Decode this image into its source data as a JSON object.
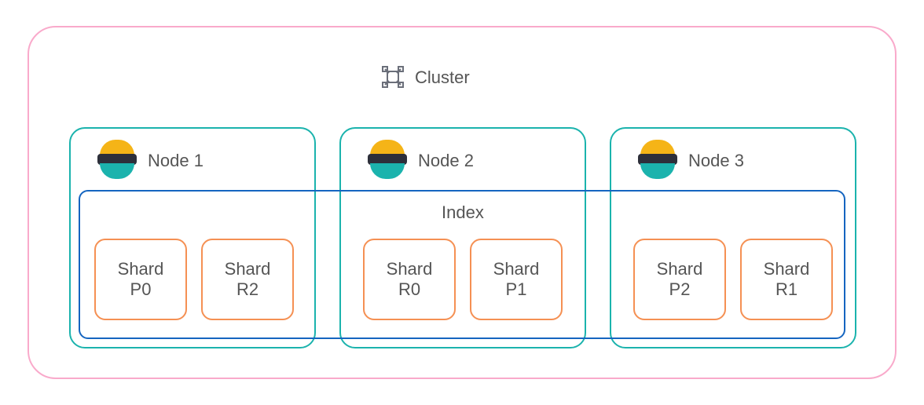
{
  "cluster": {
    "label": "Cluster"
  },
  "index": {
    "label": "Index"
  },
  "nodes": [
    {
      "label": "Node 1",
      "shards": [
        {
          "t1": "Shard",
          "t2": "P0"
        },
        {
          "t1": "Shard",
          "t2": "R2"
        }
      ]
    },
    {
      "label": "Node 2",
      "shards": [
        {
          "t1": "Shard",
          "t2": "R0"
        },
        {
          "t1": "Shard",
          "t2": "P1"
        }
      ]
    },
    {
      "label": "Node 3",
      "shards": [
        {
          "t1": "Shard",
          "t2": "P2"
        },
        {
          "t1": "Shard",
          "t2": "R1"
        }
      ]
    }
  ],
  "colors": {
    "clusterBorder": "#f9aacb",
    "nodeBorder": "#1bb3ad",
    "indexBorder": "#1565c0",
    "shardBorder": "#f59053"
  }
}
